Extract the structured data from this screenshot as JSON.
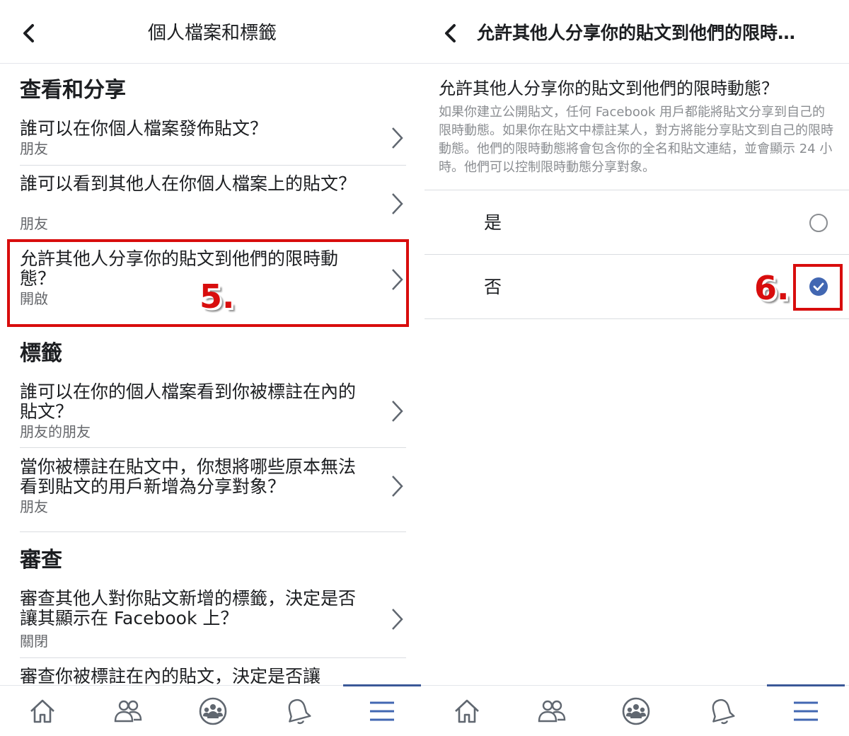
{
  "left": {
    "header": {
      "title": "個人檔案和標籤"
    },
    "sections": {
      "view_share": "查看和分享",
      "tags": "標籤",
      "review": "審查"
    },
    "rows": [
      {
        "label": "誰可以在你個人檔案發佈貼文？",
        "sub": "朋友"
      },
      {
        "label": "誰可以看到其他人在你個人檔案上的貼文？",
        "sub": "朋友"
      },
      {
        "label": "允許其他人分享你的貼文到他們的限時動態？",
        "sub": "開啟"
      },
      {
        "label": "誰可以在你的個人檔案看到你被標註在內的貼文？",
        "sub": "朋友的朋友"
      },
      {
        "label": "當你被標註在貼文中，你想將哪些原本無法看到貼文的用戶新增為分享對象？",
        "sub": "朋友"
      },
      {
        "label": "審查其他人對你貼文新增的標籤，決定是否讓其顯示在 Facebook 上？",
        "sub": "關閉"
      },
      {
        "label": "審查你被標註在內的貼文，決定是否讓",
        "sub": ""
      }
    ],
    "step_label": "5."
  },
  "right": {
    "header": {
      "title": "允許其他人分享你的貼文到他們的限時…"
    },
    "question": "允許其他人分享你的貼文到他們的限時動態？",
    "description": "如果你建立公開貼文，任何 Facebook 用戶都能將貼文分享到自己的限時動態。如果你在貼文中標註某人，對方將能分享貼文到自己的限時動態。他們的限時動態將會包含你的全名和貼文連結，並會顯示 24 小時。他們可以控制限時動態分享對象。",
    "options": [
      {
        "label": "是",
        "selected": false
      },
      {
        "label": "否",
        "selected": true
      }
    ],
    "step_label": "6."
  },
  "tabbar": {
    "icons": [
      "home-icon",
      "friends-icon",
      "groups-icon",
      "notifications-icon",
      "menu-icon"
    ],
    "active": "menu-icon"
  },
  "colors": {
    "highlight": "#d80d0d",
    "accent": "#4267b2",
    "icon": "#606770"
  }
}
